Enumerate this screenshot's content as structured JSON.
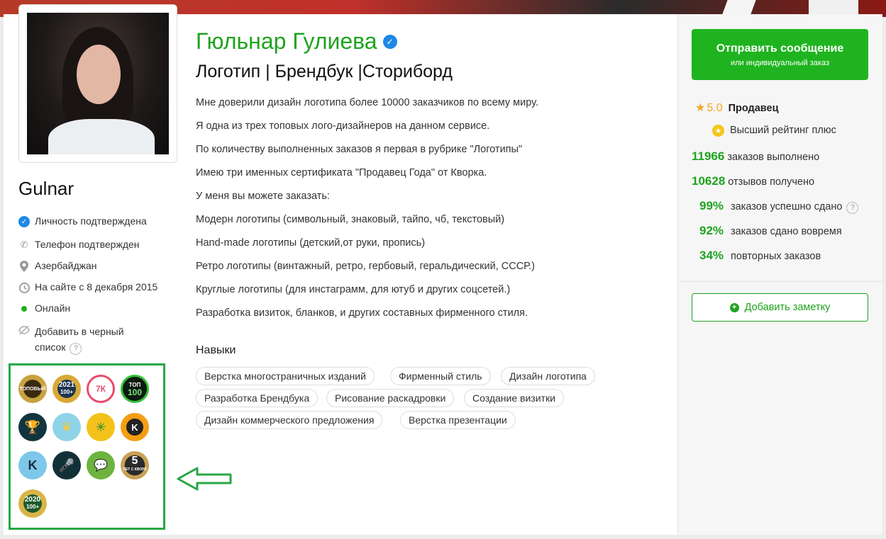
{
  "profile": {
    "username": "Gulnar",
    "full_name": "Гюльнар Гулиева",
    "headline": "Логотип | Брендбук |Сториборд"
  },
  "info": {
    "identity": "Личность подтверждена",
    "phone": "Телефон подтвержден",
    "location": "Азербайджан",
    "since": "На сайте с 8 декабря 2015",
    "status": "Онлайн",
    "blacklist_line1": "Добавить в черный",
    "blacklist_line2": "список"
  },
  "description": [
    "Мне доверили дизайн логотипа более 10000 заказчиков по всему миру.",
    "Я одна из трех топовых лого-дизайнеров на данном сервисе.",
    "По количеству выполненных заказов я первая в рубрике \"Логотипы\"",
    "Имею три именных сертификата \"Продавец Года\" от Кворка.",
    "У меня вы можете заказать:",
    "Модерн логотипы (символьный, знаковый, тайпо, чб, текстовый)",
    "Hand-made логотипы (детский,от руки, пропись)",
    "Ретро логотипы (винтажный, ретро, гербовый, геральдический, СССР.)",
    "Круглые логотипы (для инстаграмм, для ютуб и других соцсетей.)",
    "Разработка визиток, бланков, и других составных фирменного стиля."
  ],
  "skills": {
    "title": "Навыки",
    "items": [
      "Верстка многостраничных изданий",
      "Фирменный стиль",
      "Дизайн логотипа",
      "Разработка Брендбука",
      "Рисование раскадровки",
      "Создание визитки",
      "Дизайн коммерческого предложения",
      "Верстка презентации"
    ]
  },
  "badges": {
    "b1": "ТОПОВЫЙ",
    "b2": "2021",
    "b2b": "100+",
    "b3": "7К",
    "b4": "ТОП",
    "b4b": "100",
    "b8": "K",
    "b9": "K",
    "b12": "5",
    "b12b": "ЛЕТ С КВОРК",
    "b13": "2020",
    "b13b": "100+"
  },
  "sidebar": {
    "send_label": "Отправить сообщение",
    "send_sub": "или индивидуальный заказ",
    "rating": "5.0",
    "role": "Продавец",
    "top_rating": "Высший рейтинг плюс",
    "orders_num": "11966",
    "orders_label": "заказов выполнено",
    "reviews_num": "10628",
    "reviews_label": "отзывов получено",
    "success_num": "99%",
    "success_label": "заказов успешно сдано",
    "ontime_num": "92%",
    "ontime_label": "заказов сдано вовремя",
    "repeat_num": "34%",
    "repeat_label": "повторных заказов",
    "note_label": "Добавить заметку"
  },
  "colors": {
    "accent_green": "#1fa31f",
    "button_green": "#1fb41f",
    "verified_blue": "#1e88e5",
    "star": "#f5a623",
    "highlight_box": "#28a745"
  }
}
